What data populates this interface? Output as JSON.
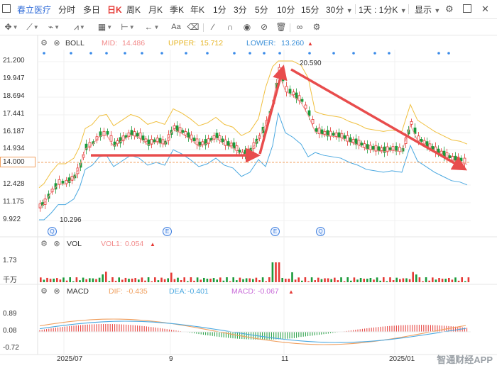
{
  "toolbar": {
    "stock_name": "春立医疗",
    "timeframes": [
      "分时",
      "多日",
      "日K",
      "周K",
      "月K",
      "季K",
      "年K",
      "1分",
      "3分",
      "5分",
      "10分",
      "15分",
      "30分"
    ],
    "active_timeframe": "日K",
    "period_select": "1天 : 1分K",
    "display_label": "显示"
  },
  "boll": {
    "name": "BOLL",
    "mid_label": "MID:",
    "mid_value": "14.486",
    "upper_label": "UPPER:",
    "upper_value": "15.712",
    "lower_label": "LOWER:",
    "lower_value": "13.260",
    "colors": {
      "mid": "#f28b8b",
      "upper": "#f0c040",
      "lower": "#4aa8e0"
    }
  },
  "vol": {
    "name": "VOL",
    "vol1_label": "VOL1:",
    "vol1_value": "0.054",
    "y_label": "1.73",
    "unit_label": "千万"
  },
  "macd": {
    "name": "MACD",
    "dif_label": "DIF:",
    "dif_value": "-0.435",
    "dea_label": "DEA:",
    "dea_value": "-0.401",
    "macd_label": "MACD:",
    "macd_value": "-0.067",
    "y_labels": [
      "0.89",
      "0.08",
      "-0.72"
    ]
  },
  "price_axis": [
    "21.200",
    "19.947",
    "18.694",
    "17.441",
    "16.187",
    "14.934",
    "12.428",
    "11.175",
    "9.922"
  ],
  "current_price": "14.000",
  "annotations": {
    "high": "20.590",
    "low": "10.296"
  },
  "x_axis": [
    "2025/07",
    "9",
    "11",
    "2025/01"
  ],
  "event_markers": [
    "Q",
    "E",
    "E",
    "Q"
  ],
  "watermark": "智通财经APP",
  "colors": {
    "up": "#e53935",
    "down": "#1a9a3a",
    "arrow": "#e84c4c",
    "accent": "#2f6bd8"
  },
  "chart_data": {
    "type": "candlestick",
    "price_ylim": [
      9.922,
      21.2
    ],
    "key_points": {
      "start_low": 10.296,
      "peak": 20.59,
      "end_close": 14.0
    },
    "trend_arrows": [
      {
        "from": 14.5,
        "to": 14.5
      },
      {
        "from": 14.6,
        "to": 20.6
      },
      {
        "from": 20.6,
        "to": 13.6
      }
    ]
  }
}
